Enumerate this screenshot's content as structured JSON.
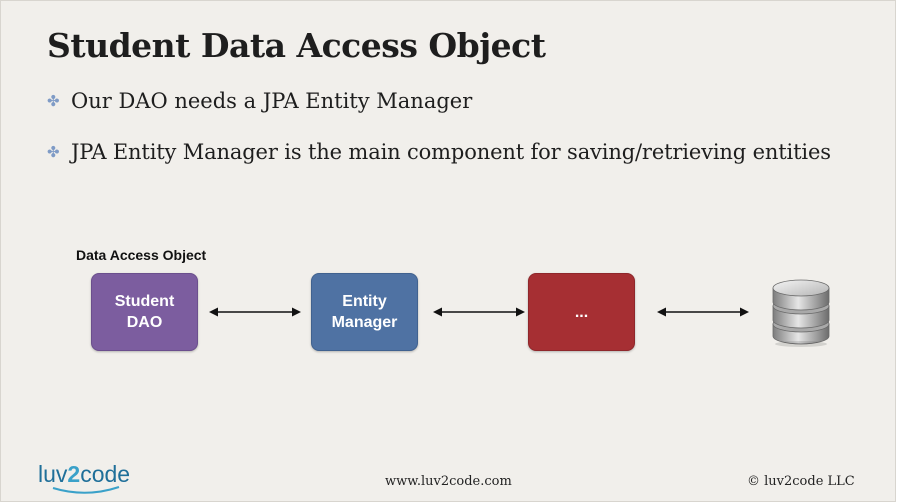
{
  "slide": {
    "title": "Student Data Access Object",
    "bullets": [
      "Our DAO needs a JPA Entity Manager",
      "JPA Entity Manager is the main component for saving/retrieving entities"
    ],
    "bullet_icon": "four-petal-flower-icon"
  },
  "diagram": {
    "group_label": "Data Access Object",
    "boxes": [
      {
        "lines": [
          "Student",
          "DAO"
        ],
        "color": "#7c5d9f"
      },
      {
        "lines": [
          "Entity",
          "Manager"
        ],
        "color": "#4f72a3"
      },
      {
        "lines": [
          "..."
        ],
        "color": "#a62f33"
      }
    ],
    "arrow_style": "bidirectional",
    "database_icon": "database-icon"
  },
  "footer": {
    "logo_parts": [
      "luv",
      "2",
      "code"
    ],
    "url": "www.luv2code.com",
    "copyright": "© luv2code LLC"
  }
}
